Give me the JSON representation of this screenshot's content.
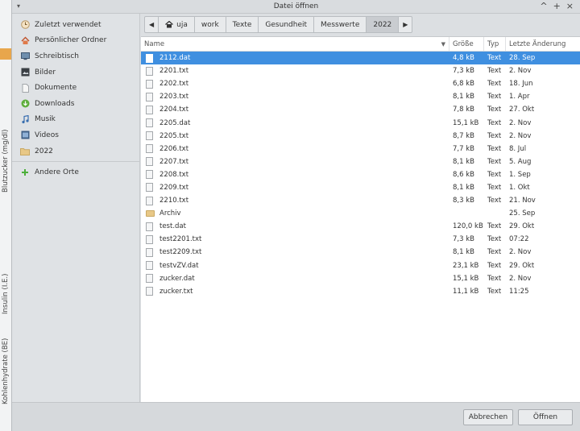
{
  "background": {
    "side_labels": [
      "Blutzucker (mg/dl)",
      "Insulin (I.E.)",
      "Kohlenhydrate (BE)"
    ]
  },
  "dialog": {
    "title": "Datei öffnen",
    "window_controls": [
      "^",
      "+",
      "×"
    ]
  },
  "sidebar": {
    "items": [
      {
        "label": "Zuletzt verwendet",
        "icon": "recent-icon"
      },
      {
        "label": "Persönlicher Ordner",
        "icon": "home-icon"
      },
      {
        "label": "Schreibtisch",
        "icon": "desktop-icon"
      },
      {
        "label": "Bilder",
        "icon": "pictures-icon"
      },
      {
        "label": "Dokumente",
        "icon": "documents-icon"
      },
      {
        "label": "Downloads",
        "icon": "downloads-icon"
      },
      {
        "label": "Musik",
        "icon": "music-icon"
      },
      {
        "label": "Videos",
        "icon": "videos-icon"
      },
      {
        "label": "2022",
        "icon": "folder-icon"
      }
    ],
    "other": {
      "label": "Andere Orte",
      "icon": "plus-icon"
    }
  },
  "pathbar": {
    "crumbs": [
      "uja",
      "work",
      "Texte",
      "Gesundheit",
      "Messwerte",
      "2022"
    ],
    "active_index": 5
  },
  "columns": {
    "name": "Name",
    "size": "Größe",
    "type": "Typ",
    "modified": "Letzte Änderung"
  },
  "files": [
    {
      "name": "2112.dat",
      "size": "4,8 kB",
      "type": "Text",
      "modified": "28. Sep",
      "kind": "file",
      "selected": true
    },
    {
      "name": "2201.txt",
      "size": "7,3 kB",
      "type": "Text",
      "modified": "2. Nov",
      "kind": "file"
    },
    {
      "name": "2202.txt",
      "size": "6,8 kB",
      "type": "Text",
      "modified": "18. Jun",
      "kind": "file"
    },
    {
      "name": "2203.txt",
      "size": "8,1 kB",
      "type": "Text",
      "modified": "1. Apr",
      "kind": "file"
    },
    {
      "name": "2204.txt",
      "size": "7,8 kB",
      "type": "Text",
      "modified": "27. Okt",
      "kind": "file"
    },
    {
      "name": "2205.dat",
      "size": "15,1 kB",
      "type": "Text",
      "modified": "2. Nov",
      "kind": "file"
    },
    {
      "name": "2205.txt",
      "size": "8,7 kB",
      "type": "Text",
      "modified": "2. Nov",
      "kind": "file"
    },
    {
      "name": "2206.txt",
      "size": "7,7 kB",
      "type": "Text",
      "modified": "8. Jul",
      "kind": "file"
    },
    {
      "name": "2207.txt",
      "size": "8,1 kB",
      "type": "Text",
      "modified": "5. Aug",
      "kind": "file"
    },
    {
      "name": "2208.txt",
      "size": "8,6 kB",
      "type": "Text",
      "modified": "1. Sep",
      "kind": "file"
    },
    {
      "name": "2209.txt",
      "size": "8,1 kB",
      "type": "Text",
      "modified": "1. Okt",
      "kind": "file"
    },
    {
      "name": "2210.txt",
      "size": "8,3 kB",
      "type": "Text",
      "modified": "21. Nov",
      "kind": "file"
    },
    {
      "name": "Archiv",
      "size": "",
      "type": "",
      "modified": "25. Sep",
      "kind": "folder"
    },
    {
      "name": "test.dat",
      "size": "120,0 kB",
      "type": "Text",
      "modified": "29. Okt",
      "kind": "file"
    },
    {
      "name": "test2201.txt",
      "size": "7,3 kB",
      "type": "Text",
      "modified": "07:22",
      "kind": "file"
    },
    {
      "name": "test2209.txt",
      "size": "8,1 kB",
      "type": "Text",
      "modified": "2. Nov",
      "kind": "file"
    },
    {
      "name": "testvZV.dat",
      "size": "23,1 kB",
      "type": "Text",
      "modified": "29. Okt",
      "kind": "file"
    },
    {
      "name": "zucker.dat",
      "size": "15,1 kB",
      "type": "Text",
      "modified": "2. Nov",
      "kind": "file"
    },
    {
      "name": "zucker.txt",
      "size": "11,1 kB",
      "type": "Text",
      "modified": "11:25",
      "kind": "file"
    }
  ],
  "footer": {
    "cancel_label": "Abbrechen",
    "open_label": "Öffnen"
  },
  "colors": {
    "selection": "#3f8fe0",
    "strip_red": "#e59a9a",
    "strip_green": "#9fd39f",
    "strip_blue": "#9a9ae6"
  }
}
